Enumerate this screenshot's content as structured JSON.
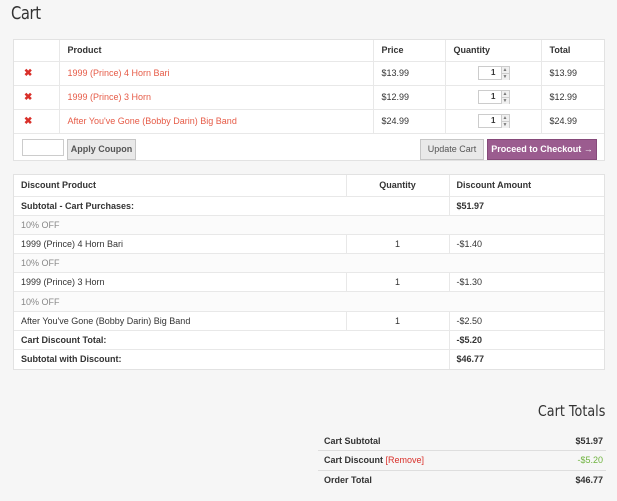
{
  "page_title": "Cart",
  "cart": {
    "headers": {
      "product": "Product",
      "price": "Price",
      "quantity": "Quantity",
      "total": "Total"
    },
    "remove_glyph": "✖",
    "items": [
      {
        "product": "1999 (Prince) 4 Horn Bari",
        "price": "$13.99",
        "quantity": "1",
        "total": "$13.99"
      },
      {
        "product": "1999 (Prince) 3 Horn",
        "price": "$12.99",
        "quantity": "1",
        "total": "$12.99"
      },
      {
        "product": "After You've Gone (Bobby Darin) Big Band",
        "price": "$24.99",
        "quantity": "1",
        "total": "$24.99"
      }
    ],
    "coupon_placeholder": "",
    "apply_coupon_label": "Apply Coupon",
    "update_cart_label": "Update Cart",
    "checkout_label": "Proceed to Checkout →",
    "checkout_color": "#9b5c8f"
  },
  "discounts": {
    "headers": {
      "product": "Discount Product",
      "quantity": "Quantity",
      "amount": "Discount Amount"
    },
    "subtotal_label": "Subtotal - Cart Purchases:",
    "subtotal_value": "$51.97",
    "items": [
      {
        "percent": "10% OFF",
        "product": "1999 (Prince) 4 Horn Bari",
        "quantity": "1",
        "amount": "-$1.40"
      },
      {
        "percent": "10% OFF",
        "product": "1999 (Prince) 3 Horn",
        "quantity": "1",
        "amount": "-$1.30"
      },
      {
        "percent": "10% OFF",
        "product": "After You've Gone (Bobby Darin) Big Band",
        "quantity": "1",
        "amount": "-$2.50"
      }
    ],
    "total_label": "Cart Discount Total:",
    "total_value": "-$5.20",
    "with_discount_label": "Subtotal with Discount:",
    "with_discount_value": "$46.77"
  },
  "totals": {
    "title": "Cart Totals",
    "subtotal_label": "Cart Subtotal",
    "subtotal_value": "$51.97",
    "discount_label": "Cart Discount",
    "discount_remove": "[Remove]",
    "discount_value": "-$5.20",
    "order_total_label": "Order Total",
    "order_total_value": "$46.77",
    "discount_color": "#6fb33f"
  }
}
